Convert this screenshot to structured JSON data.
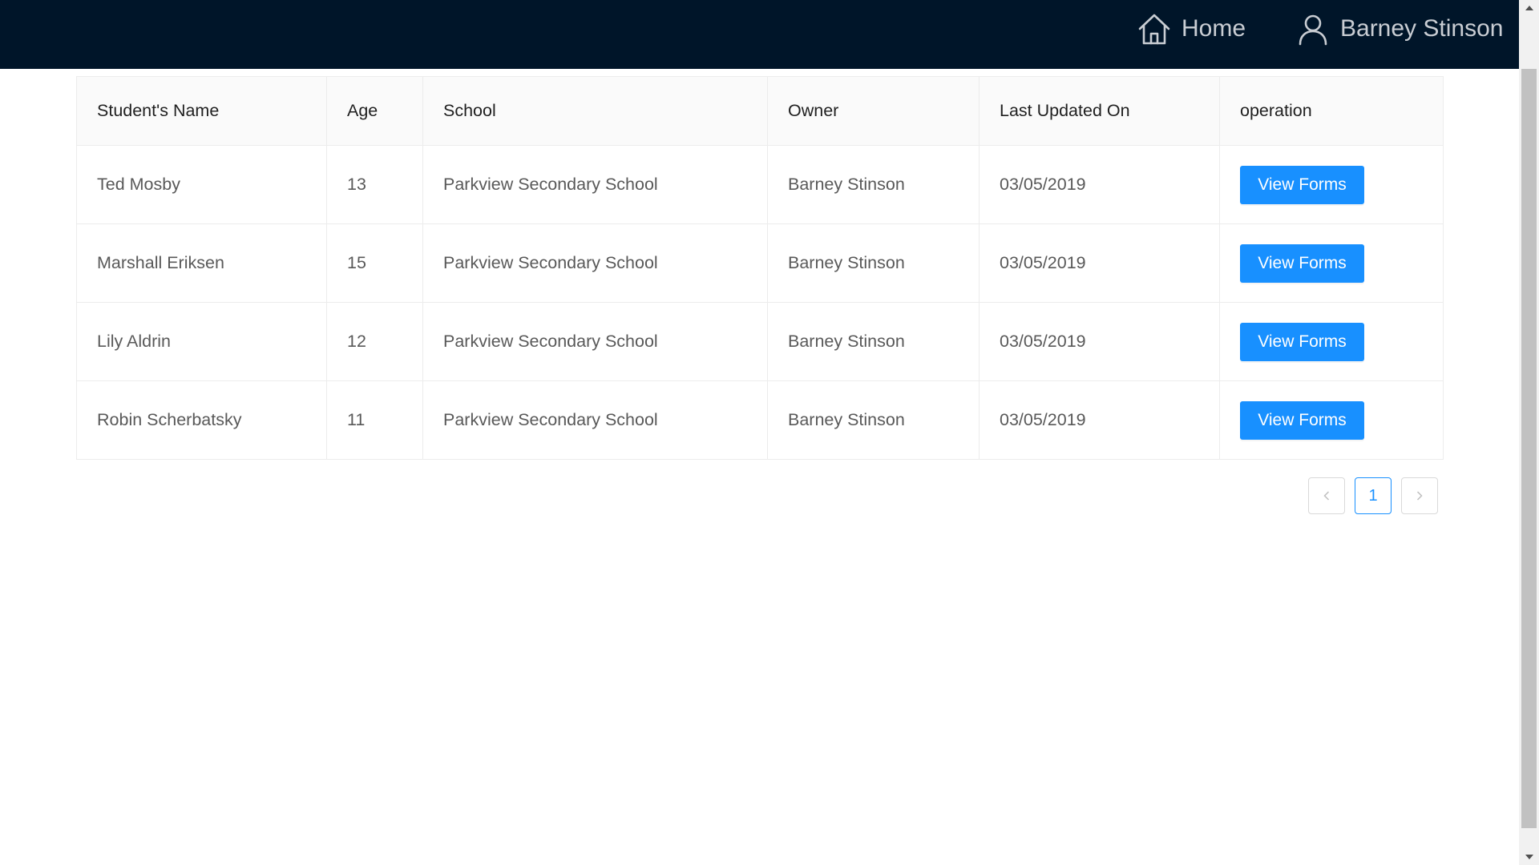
{
  "header": {
    "home_label": "Home",
    "user_label": "Barney Stinson"
  },
  "table": {
    "columns": [
      "Student's Name",
      "Age",
      "School",
      "Owner",
      "Last Updated On",
      "operation"
    ],
    "rows": [
      {
        "name": "Ted Mosby",
        "age": "13",
        "school": "Parkview Secondary School",
        "owner": "Barney Stinson",
        "updated": "03/05/2019",
        "action": "View Forms"
      },
      {
        "name": "Marshall Eriksen",
        "age": "15",
        "school": "Parkview Secondary School",
        "owner": "Barney Stinson",
        "updated": "03/05/2019",
        "action": "View Forms"
      },
      {
        "name": "Lily Aldrin",
        "age": "12",
        "school": "Parkview Secondary School",
        "owner": "Barney Stinson",
        "updated": "03/05/2019",
        "action": "View Forms"
      },
      {
        "name": "Robin Scherbatsky",
        "age": "11",
        "school": "Parkview Secondary School",
        "owner": "Barney Stinson",
        "updated": "03/05/2019",
        "action": "View Forms"
      }
    ]
  },
  "pagination": {
    "current_page": "1"
  },
  "colors": {
    "header_bg": "#001529",
    "accent": "#1890ff"
  }
}
